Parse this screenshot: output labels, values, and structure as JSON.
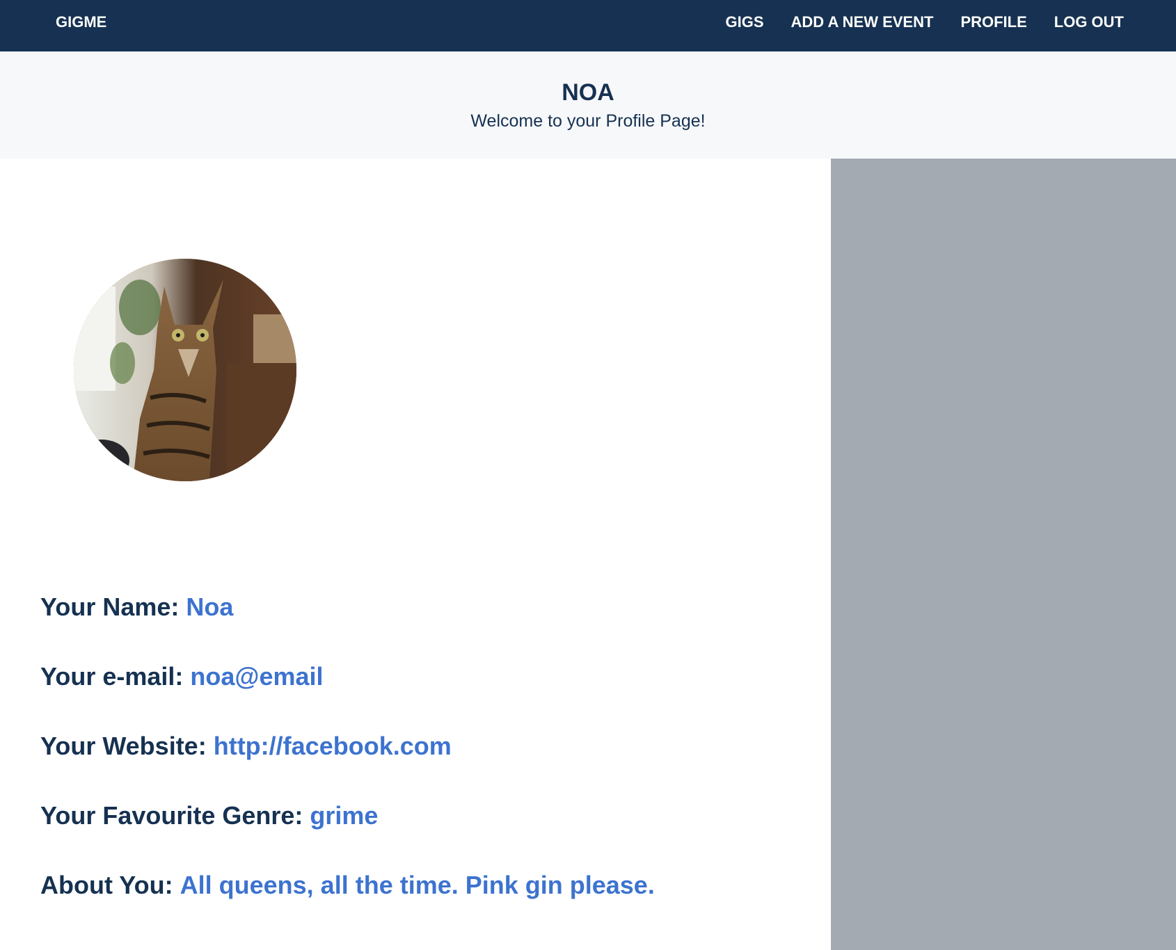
{
  "nav": {
    "brand": "GIGME",
    "links": [
      "GIGS",
      "ADD A NEW EVENT",
      "PROFILE",
      "LOG OUT"
    ]
  },
  "hero": {
    "title": "NOA",
    "subtitle": "Welcome to your Profile Page!"
  },
  "profile": {
    "avatar_icon": "cat-photo",
    "name_label": "Your Name:",
    "name_value": "Noa",
    "email_label": "Your e-mail:",
    "email_value": "noa@email",
    "website_label": "Your Website:",
    "website_value": "http://facebook.com",
    "genre_label": "Your Favourite Genre:",
    "genre_value": "grime",
    "about_label": "About You:",
    "about_value": "All queens, all the time. Pink gin please."
  },
  "colors": {
    "navbar": "#163151",
    "hero_bg": "#f7f8fa",
    "side_panel": "#a4aab1",
    "label_text": "#163151",
    "value_text": "#3d73cf"
  }
}
